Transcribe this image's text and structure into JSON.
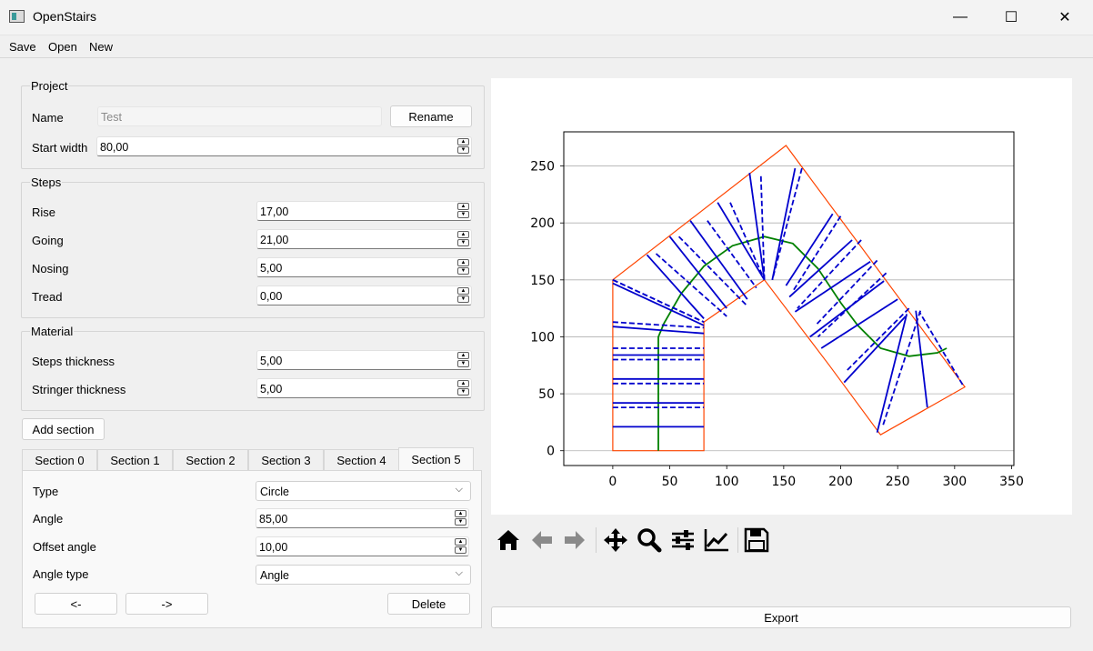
{
  "window": {
    "title": "OpenStairs",
    "minimize": "—",
    "maximize": "☐",
    "close": "✕"
  },
  "menu": {
    "save": "Save",
    "open": "Open",
    "new": "New"
  },
  "project": {
    "legend": "Project",
    "name_label": "Name",
    "name_value": "Test",
    "rename_label": "Rename",
    "start_width_label": "Start width",
    "start_width_value": "80,00"
  },
  "steps": {
    "legend": "Steps",
    "rise_label": "Rise",
    "rise_value": "17,00",
    "going_label": "Going",
    "going_value": "21,00",
    "nosing_label": "Nosing",
    "nosing_value": "5,00",
    "tread_label": "Tread",
    "tread_value": "0,00"
  },
  "material": {
    "legend": "Material",
    "steps_thickness_label": "Steps thickness",
    "steps_thickness_value": "5,00",
    "stringer_thickness_label": "Stringer thickness",
    "stringer_thickness_value": "5,00"
  },
  "add_section_label": "Add section",
  "tabs": [
    "Section 0",
    "Section 1",
    "Section 2",
    "Section 3",
    "Section 4",
    "Section 5"
  ],
  "active_tab": "Section 5",
  "section": {
    "type_label": "Type",
    "type_value": "Circle",
    "angle_label": "Angle",
    "angle_value": "85,00",
    "offset_angle_label": "Offset angle",
    "offset_angle_value": "10,00",
    "angle_type_label": "Angle type",
    "angle_type_value": "Angle",
    "prev_label": "<-",
    "next_label": "->",
    "delete_label": "Delete"
  },
  "export_label": "Export",
  "toolbar_icons": [
    "home-icon",
    "back-arrow-icon",
    "forward-arrow-icon",
    "pan-icon",
    "zoom-icon",
    "configure-subplots-icon",
    "edit-axis-icon",
    "save-figure-icon"
  ],
  "chart_data": {
    "type": "line",
    "x_ticks": [
      "0",
      "50",
      "100",
      "150",
      "200",
      "250",
      "300",
      "350"
    ],
    "y_ticks": [
      "0",
      "50",
      "100",
      "150",
      "200",
      "250"
    ],
    "xlim": [
      -43,
      352
    ],
    "ylim": [
      -13,
      280
    ],
    "grid": "horizontal",
    "colors": {
      "outline": "#ff4500",
      "walkline": "#008000",
      "steps": "#0000cd"
    },
    "outline": [
      [
        [
          0,
          0
        ],
        [
          0,
          150
        ],
        [
          152,
          268
        ],
        [
          309,
          56
        ],
        [
          235,
          14
        ],
        [
          190,
          75
        ],
        [
          133,
          150
        ],
        [
          80,
          113
        ],
        [
          80,
          0
        ]
      ]
    ],
    "walkline": [
      [
        40,
        0
      ],
      [
        40,
        100
      ],
      [
        45,
        112
      ],
      [
        60,
        138
      ],
      [
        80,
        162
      ],
      [
        105,
        180
      ],
      [
        133,
        188
      ],
      [
        158,
        182
      ],
      [
        180,
        160
      ],
      [
        200,
        130
      ],
      [
        215,
        110
      ],
      [
        235,
        90
      ],
      [
        260,
        83
      ],
      [
        285,
        86
      ],
      [
        293,
        90
      ]
    ],
    "steps_solid": [
      [
        [
          0,
          21
        ],
        [
          80,
          21
        ]
      ],
      [
        [
          0,
          42
        ],
        [
          80,
          42
        ]
      ],
      [
        [
          0,
          63
        ],
        [
          80,
          63
        ]
      ],
      [
        [
          0,
          84
        ],
        [
          80,
          84
        ]
      ],
      [
        [
          0,
          109
        ],
        [
          80,
          103
        ]
      ],
      [
        [
          0,
          147
        ],
        [
          80,
          110
        ]
      ],
      [
        [
          30,
          172
        ],
        [
          80,
          116
        ]
      ],
      [
        [
          50,
          188
        ],
        [
          100,
          125
        ]
      ],
      [
        [
          68,
          202
        ],
        [
          118,
          133
        ]
      ],
      [
        [
          92,
          218
        ],
        [
          133,
          150
        ]
      ],
      [
        [
          120,
          244
        ],
        [
          133,
          150
        ]
      ],
      [
        [
          160,
          248
        ],
        [
          140,
          150
        ]
      ],
      [
        [
          193,
          208
        ],
        [
          152,
          145
        ]
      ],
      [
        [
          210,
          185
        ],
        [
          155,
          135
        ]
      ],
      [
        [
          226,
          166
        ],
        [
          160,
          122
        ]
      ],
      [
        [
          238,
          149
        ],
        [
          173,
          100
        ]
      ],
      [
        [
          250,
          133
        ],
        [
          183,
          90
        ]
      ],
      [
        [
          257,
          118
        ],
        [
          203,
          60
        ]
      ],
      [
        [
          258,
          120
        ],
        [
          232,
          16
        ]
      ],
      [
        [
          266,
          123
        ],
        [
          276,
          38
        ]
      ]
    ],
    "steps_dashed": [
      [
        [
          0,
          38
        ],
        [
          80,
          38
        ]
      ],
      [
        [
          0,
          59
        ],
        [
          80,
          59
        ]
      ],
      [
        [
          0,
          80
        ],
        [
          80,
          80
        ]
      ],
      [
        [
          0,
          90
        ],
        [
          80,
          90
        ]
      ],
      [
        [
          0,
          113
        ],
        [
          80,
          108
        ]
      ],
      [
        [
          0,
          150
        ],
        [
          80,
          113
        ]
      ],
      [
        [
          0,
          150
        ],
        [
          80,
          113
        ]
      ],
      [
        [
          38,
          173
        ],
        [
          100,
          118
        ]
      ],
      [
        [
          58,
          188
        ],
        [
          118,
          127
        ]
      ],
      [
        [
          83,
          202
        ],
        [
          126,
          143
        ]
      ],
      [
        [
          103,
          218
        ],
        [
          133,
          150
        ]
      ],
      [
        [
          130,
          241
        ],
        [
          133,
          150
        ]
      ],
      [
        [
          166,
          248
        ],
        [
          140,
          150
        ]
      ],
      [
        [
          200,
          206
        ],
        [
          158,
          140
        ]
      ],
      [
        [
          218,
          185
        ],
        [
          162,
          125
        ]
      ],
      [
        [
          232,
          167
        ],
        [
          178,
          110
        ]
      ],
      [
        [
          240,
          156
        ],
        [
          180,
          100
        ]
      ],
      [
        [
          260,
          125
        ],
        [
          205,
          70
        ]
      ],
      [
        [
          270,
          123
        ],
        [
          237,
          22
        ]
      ],
      [
        [
          307,
          58
        ],
        [
          269,
          122
        ]
      ]
    ]
  }
}
